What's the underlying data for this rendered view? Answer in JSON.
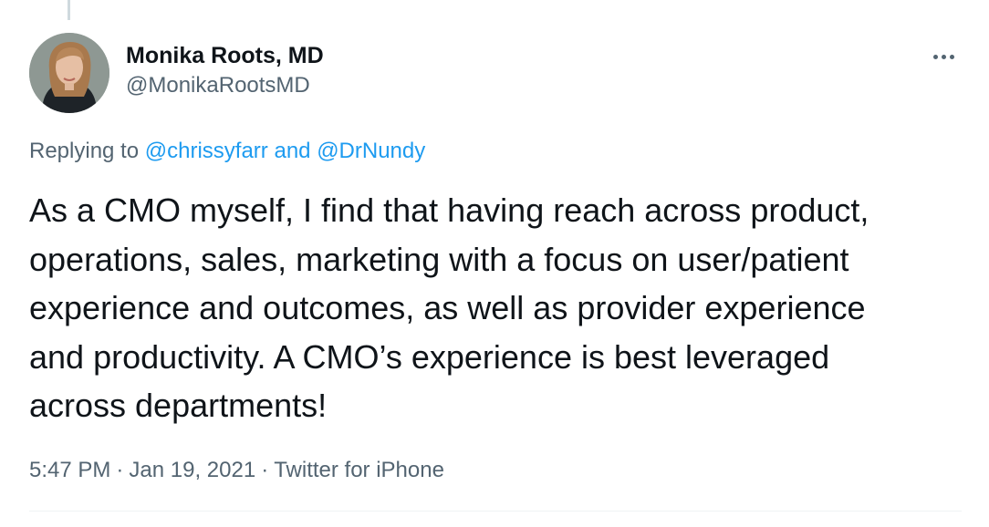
{
  "tweet": {
    "author": {
      "display_name": "Monika Roots, MD",
      "handle": "@MonikaRootsMD",
      "avatar_icon": "profile-photo"
    },
    "more_icon": "ellipsis-horizontal-icon",
    "reply": {
      "prefix": "Replying to",
      "mentions": [
        "@chrissyfarr",
        "@DrNundy"
      ],
      "joiner": "and"
    },
    "text_lines": [
      "As a CMO myself, I find that having reach across product,",
      "operations, sales, marketing with a focus on user/patient",
      "experience and outcomes, as well as provider experience",
      "and productivity. A CMO’s experience is best leveraged",
      "across departments!"
    ],
    "meta": {
      "time": "5:47 PM",
      "date": "Jan 19, 2021",
      "separator": "·",
      "source": "Twitter for iPhone"
    }
  },
  "colors": {
    "primary_text": "#0f1419",
    "secondary_text": "#536471",
    "link": "#1d9bf0",
    "divider": "#eff3f4"
  }
}
